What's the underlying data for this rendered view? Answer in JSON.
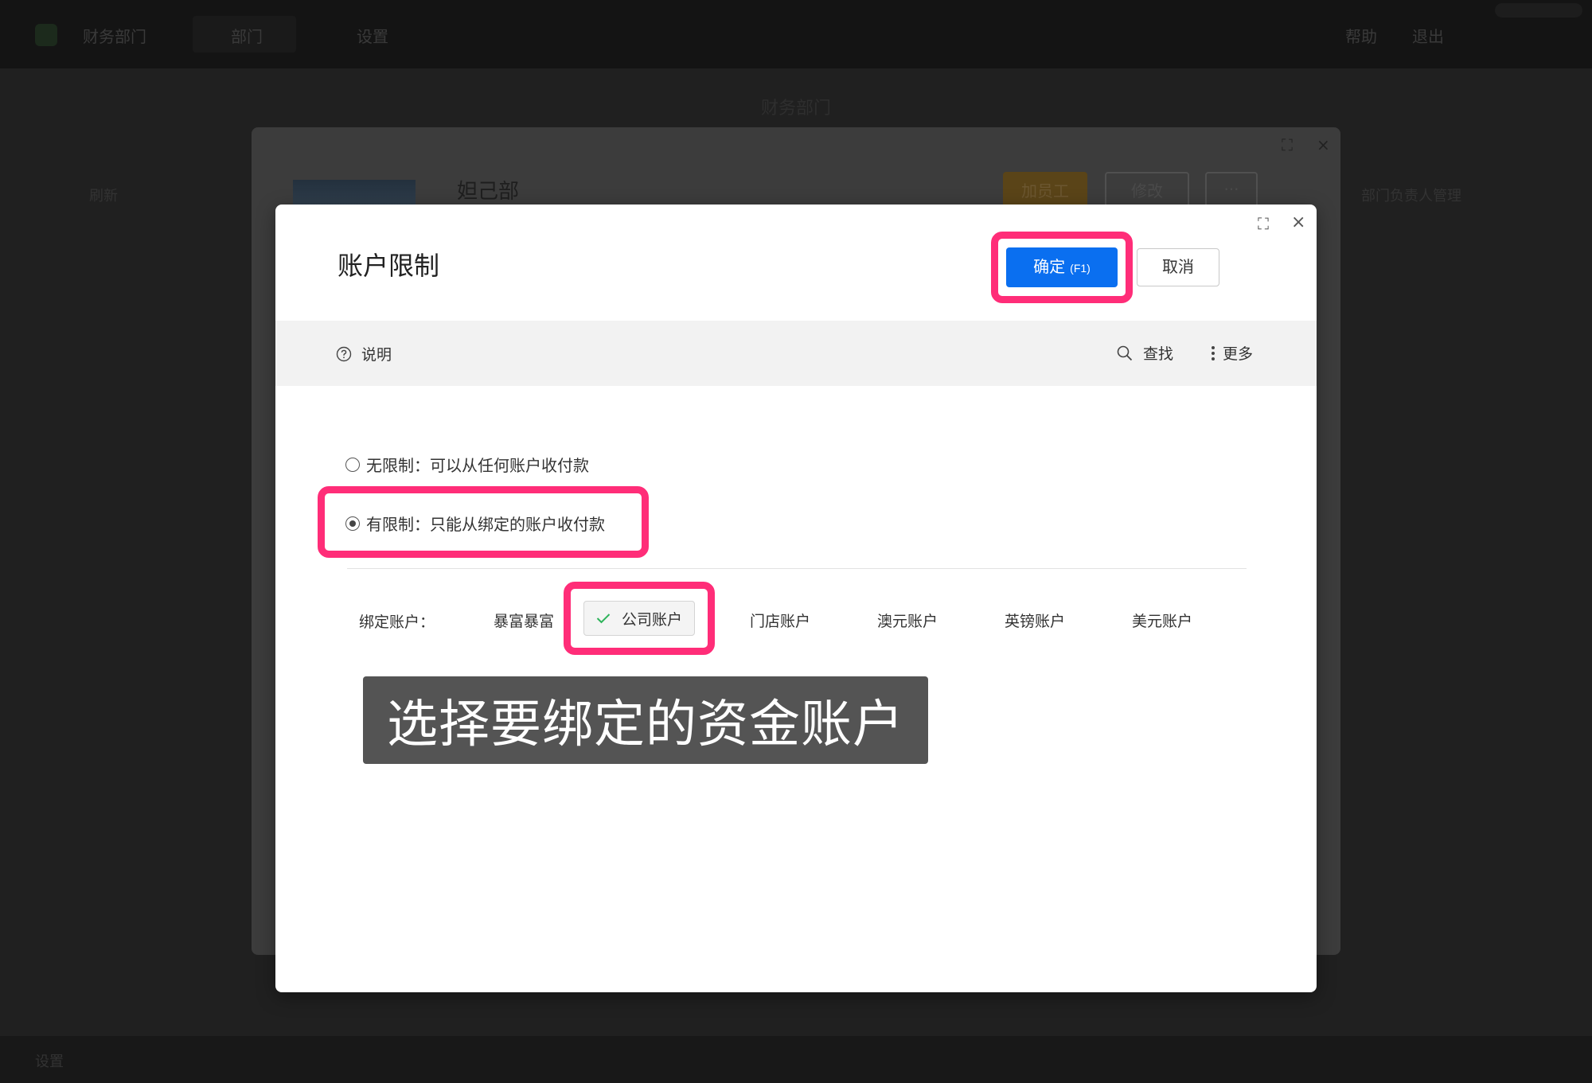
{
  "background": {
    "nav": {
      "brand": "财务部门",
      "tab1": "部门",
      "tab2": "设置",
      "right1": "帮助",
      "right2": "退出"
    },
    "page_title": "财务部门",
    "left_hint": "刷新",
    "right_hint": "部门负责人管理",
    "modal": {
      "name": "妲己部",
      "add_staff": "加员工",
      "edit": "修改",
      "more": "···"
    },
    "footer": "设置"
  },
  "dialog": {
    "title": "账户限制",
    "ok_label": "确定",
    "ok_hotkey": "(F1)",
    "cancel_label": "取消",
    "toolbar": {
      "help": "说明",
      "search": "查找",
      "more": "更多"
    },
    "options": [
      {
        "label": "无限制：可以从任何账户收付款",
        "selected": false
      },
      {
        "label": "有限制：只能从绑定的账户收付款",
        "selected": true
      }
    ],
    "bind_label": "绑定账户：",
    "accounts": [
      {
        "name": "暴富暴富",
        "selected": false
      },
      {
        "name": "公司账户",
        "selected": true
      },
      {
        "name": "门店账户",
        "selected": false
      },
      {
        "name": "澳元账户",
        "selected": false
      },
      {
        "name": "英镑账户",
        "selected": false
      },
      {
        "name": "美元账户",
        "selected": false
      }
    ]
  },
  "caption": "选择要绑定的资金账户",
  "colors": {
    "primary": "#0a6ff0",
    "highlight": "#ff2d78",
    "check": "#2db35a"
  }
}
